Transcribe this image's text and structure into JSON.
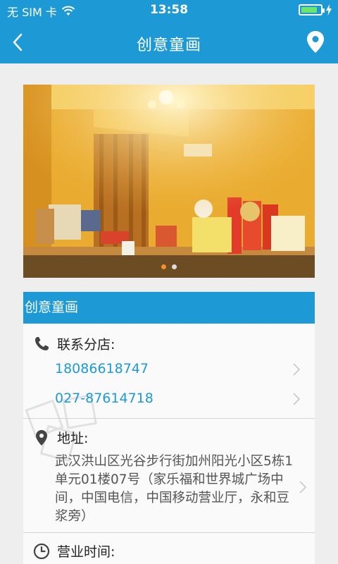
{
  "status": {
    "carrier": "无 SIM 卡",
    "time": "13:58"
  },
  "nav": {
    "title": "创意童画"
  },
  "banner": {
    "dots": 2,
    "active_dot": 0
  },
  "card": {
    "title": "创意童画",
    "contact_label": "联系分店:",
    "phones": [
      "18086618747",
      "027-87614718"
    ],
    "address_label": "地址:",
    "address": "武汉洪山区光谷步行街加州阳光小区5栋1单元01楼07号（家乐福和世界城广场中间，中国电信，中国移动营业厅，永和豆浆旁）",
    "hours_label": "营业时间:"
  },
  "colors": {
    "primary": "#1d9ad6",
    "active_dot": "#f0912a"
  },
  "icons": {
    "back": "chevron-left-icon",
    "location": "map-pin-icon",
    "phone": "phone-icon",
    "pin": "map-pin-icon",
    "clock": "clock-icon"
  }
}
